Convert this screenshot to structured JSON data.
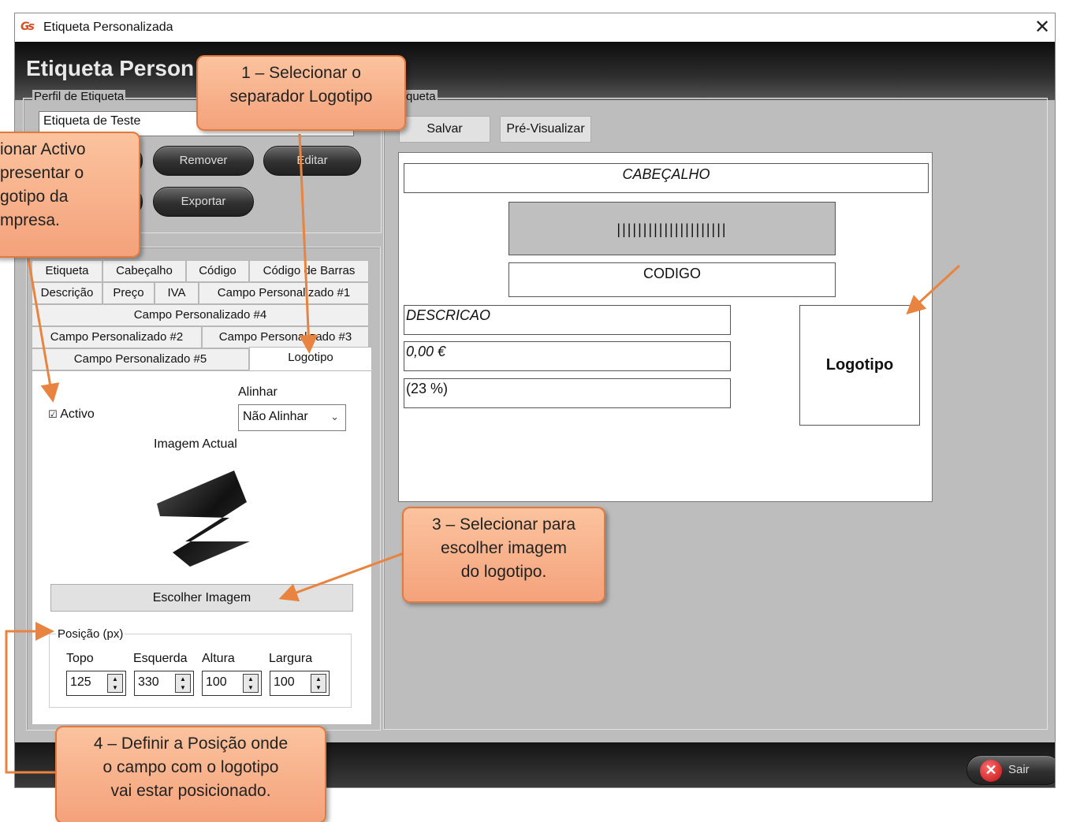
{
  "window": {
    "title": "Etiqueta Personalizada",
    "close_glyph": "✕",
    "app_logo_text": "Gs"
  },
  "main_heading": "Etiqueta Person",
  "profile": {
    "group_label": "Perfil de Etiqueta",
    "selected_value": "Etiqueta de Teste",
    "buttons": {
      "remove": "Remover",
      "edit": "Editar",
      "export": "Exportar"
    }
  },
  "tabs": {
    "row1": [
      "Etiqueta",
      "Cabeçalho",
      "Código",
      "Código de Barras"
    ],
    "row2": [
      "Descrição",
      "Preço",
      "IVA",
      "Campo Personalizado #1"
    ],
    "row3": [
      "Campo Personalizado #4"
    ],
    "row4": [
      "Campo Personalizado #2",
      "Campo Personalizado #3"
    ],
    "row5": [
      "Campo Personalizado #5",
      "Logotipo"
    ],
    "active": "Logotipo"
  },
  "logo_tab": {
    "active_checkbox": {
      "glyph": "☑",
      "label": "Activo",
      "checked": true
    },
    "align_label": "Alinhar",
    "align_value": "Não Alinhar",
    "current_image_label": "Imagem Actual",
    "choose_image_button": "Escolher Imagem",
    "position": {
      "group_label": "Posição (px)",
      "fields": [
        {
          "label": "Topo",
          "value": "125"
        },
        {
          "label": "Esquerda",
          "value": "330"
        },
        {
          "label": "Altura",
          "value": "100"
        },
        {
          "label": "Largura",
          "value": "100"
        }
      ]
    }
  },
  "label_panel": {
    "group_label_fragment": "queta",
    "save_button": "Salvar",
    "preview_button": "Pré-Visualizar"
  },
  "preview": {
    "header": "CABEÇALHO",
    "barcode": "|||||||||||||||||||||",
    "code": "CODIGO",
    "description": "DESCRICAO",
    "price": "0,00 €",
    "vat": "(23 %)",
    "logo": "Logotipo"
  },
  "exit_button": "Sair",
  "callouts": {
    "c1": [
      "1 – Selecionar o",
      "separador Logotipo"
    ],
    "c2": [
      "ionar Activo",
      "presentar o",
      "gotipo da",
      "mpresa."
    ],
    "c3": [
      "3 – Selecionar para",
      "escolher imagem",
      "do logotipo."
    ],
    "c4": [
      "4 – Definir a Posição onde",
      "o campo com o logotipo",
      "vai estar posicionado."
    ]
  },
  "colors": {
    "callout_fill": "#f7b08a",
    "callout_border": "#e07a3e",
    "arrow": "#e8843f",
    "window_bg": "#bdbdbd"
  }
}
